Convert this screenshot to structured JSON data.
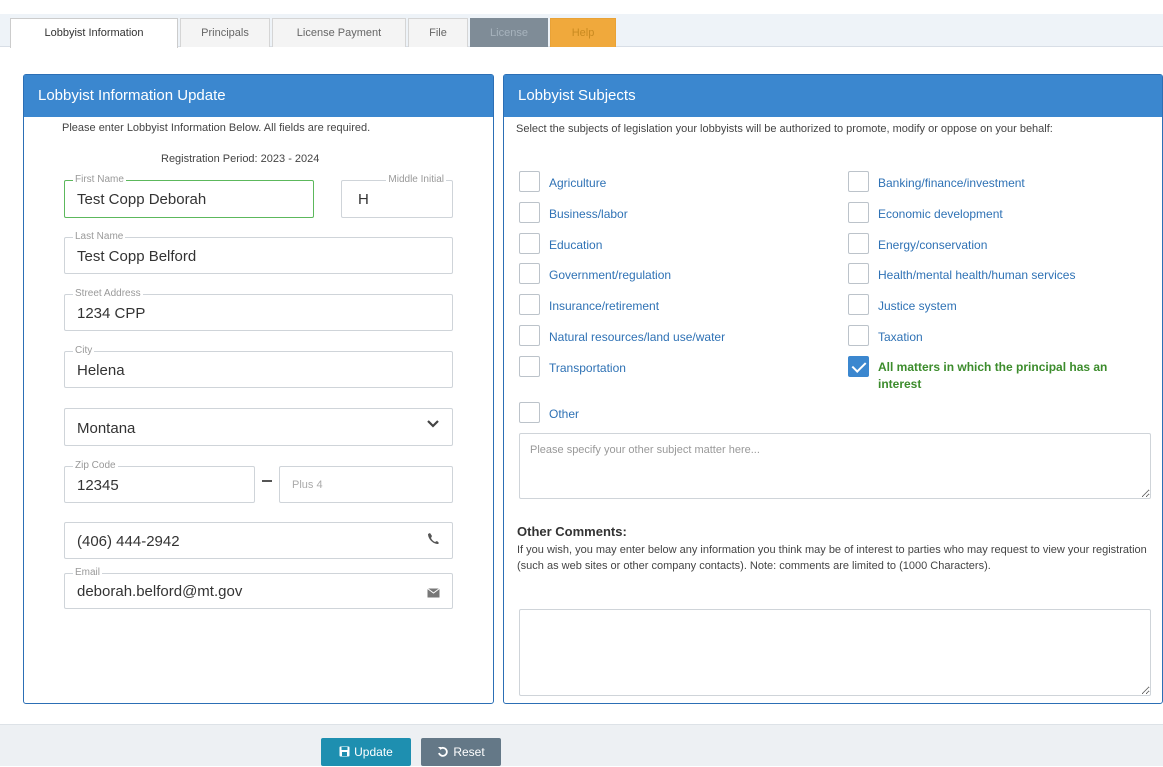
{
  "tabs": [
    {
      "label": "Lobbyist Information"
    },
    {
      "label": "Principals"
    },
    {
      "label": "License Payment"
    },
    {
      "label": "File"
    },
    {
      "label": "License"
    },
    {
      "label": "Help"
    }
  ],
  "left_panel": {
    "title": "Lobbyist Information Update",
    "instruction": "Please enter Lobbyist Information Below.  All fields are required.",
    "period": "Registration Period: 2023 - 2024",
    "first_name": {
      "label": "First Name",
      "value": "Test Copp Deborah"
    },
    "middle_initial": {
      "label": "Middle Initial",
      "value": "H"
    },
    "last_name": {
      "label": "Last Name",
      "value": "Test Copp Belford"
    },
    "street": {
      "label": "Street Address",
      "value": "1234 CPP"
    },
    "city": {
      "label": "City",
      "value": "Helena"
    },
    "state": {
      "value": "Montana"
    },
    "zip": {
      "label": "Zip Code",
      "value": "12345",
      "plus4_placeholder": "Plus 4"
    },
    "phone": {
      "value": "(406) 444-2942"
    },
    "email": {
      "label": "Email",
      "value": "deborah.belford@mt.gov"
    }
  },
  "right_panel": {
    "title": "Lobbyist Subjects",
    "instruction": "Select the subjects of legislation your lobbyists will be authorized to promote, modify or oppose on your behalf:",
    "subjects_left": [
      {
        "label": "Agriculture",
        "checked": false
      },
      {
        "label": "Business/labor",
        "checked": false
      },
      {
        "label": "Education",
        "checked": false
      },
      {
        "label": "Government/regulation",
        "checked": false
      },
      {
        "label": "Insurance/retirement",
        "checked": false
      },
      {
        "label": "Natural resources/land use/water",
        "checked": false
      },
      {
        "label": "Transportation",
        "checked": false
      }
    ],
    "subjects_right": [
      {
        "label": "Banking/finance/investment",
        "checked": false
      },
      {
        "label": "Economic development",
        "checked": false
      },
      {
        "label": "Energy/conservation",
        "checked": false
      },
      {
        "label": "Health/mental health/human services",
        "checked": false
      },
      {
        "label": "Justice system",
        "checked": false
      },
      {
        "label": "Taxation",
        "checked": false
      },
      {
        "label": "All matters in which the principal has an interest",
        "checked": true
      }
    ],
    "other": {
      "label": "Other",
      "checked": false
    },
    "other_placeholder": "Please specify your other subject matter here...",
    "comments_title": "Other Comments:",
    "comments_text": "If you wish, you may enter below any information you think may be of interest to parties who may request to view your registration (such as web sites or other company contacts). Note: comments are limited to (1000 Characters).",
    "comments_value": ""
  },
  "buttons": {
    "update": "Update",
    "reset": "Reset"
  },
  "colors": {
    "panel_header": "#3b87cf",
    "checked_label": "#3c8c2c",
    "help_tab": "#f0a93c"
  }
}
